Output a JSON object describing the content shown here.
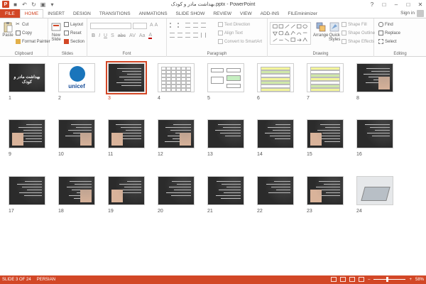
{
  "window": {
    "title": "بهداشت مادر و کودک.pptx - PowerPoint",
    "signin": "Sign in"
  },
  "tabs": [
    "FILE",
    "HOME",
    "INSERT",
    "DESIGN",
    "TRANSITIONS",
    "ANIMATIONS",
    "SLIDE SHOW",
    "REVIEW",
    "VIEW",
    "ADD-INS",
    "FILEminimizer"
  ],
  "ribbon": {
    "clipboard": {
      "paste": "Paste",
      "cut": "Cut",
      "copy": "Copy",
      "format_painter": "Format Painter",
      "label": "Clipboard"
    },
    "slides": {
      "new_slide": "New",
      "new_slide2": "Slide",
      "layout": "Layout",
      "reset": "Reset",
      "section": "Section",
      "label": "Slides"
    },
    "font": {
      "label": "Font"
    },
    "paragraph": {
      "text_direction": "Text Direction",
      "align_text": "Align Text",
      "smartart": "Convert to SmartArt",
      "label": "Paragraph"
    },
    "drawing": {
      "arrange": "Arrange",
      "quick_styles": "Quick",
      "quick_styles2": "Styles",
      "shape_fill": "Shape Fill",
      "shape_outline": "Shape Outline",
      "shape_effects": "Shape Effects",
      "label": "Drawing"
    },
    "editing": {
      "find": "Find",
      "replace": "Replace",
      "select": "Select",
      "label": "Editing"
    }
  },
  "slides": {
    "selected": 3,
    "items": [
      {
        "num": "1",
        "kind": "title",
        "title": "بهداشت مادر و کودک"
      },
      {
        "num": "2",
        "kind": "unicef",
        "title": "unicef"
      },
      {
        "num": "3",
        "kind": "dark"
      },
      {
        "num": "4",
        "kind": "table"
      },
      {
        "num": "5",
        "kind": "diagram"
      },
      {
        "num": "6",
        "kind": "colortable"
      },
      {
        "num": "7",
        "kind": "colortable2"
      },
      {
        "num": "8",
        "kind": "darkphoto"
      },
      {
        "num": "9",
        "kind": "darkphoto"
      },
      {
        "num": "10",
        "kind": "darkphoto"
      },
      {
        "num": "11",
        "kind": "darkphoto"
      },
      {
        "num": "12",
        "kind": "darkphoto"
      },
      {
        "num": "13",
        "kind": "dark"
      },
      {
        "num": "14",
        "kind": "dark"
      },
      {
        "num": "15",
        "kind": "darkphoto"
      },
      {
        "num": "16",
        "kind": "dark"
      },
      {
        "num": "17",
        "kind": "dark"
      },
      {
        "num": "18",
        "kind": "darkphoto"
      },
      {
        "num": "19",
        "kind": "darkphoto"
      },
      {
        "num": "20",
        "kind": "dark"
      },
      {
        "num": "21",
        "kind": "dark"
      },
      {
        "num": "22",
        "kind": "dark"
      },
      {
        "num": "23",
        "kind": "darkphoto"
      },
      {
        "num": "24",
        "kind": "laptop"
      }
    ]
  },
  "status": {
    "slide_info": "SLIDE 3 OF 24",
    "language": "PERSIAN",
    "zoom": "58%"
  },
  "colors": {
    "accent": "#d24726"
  }
}
